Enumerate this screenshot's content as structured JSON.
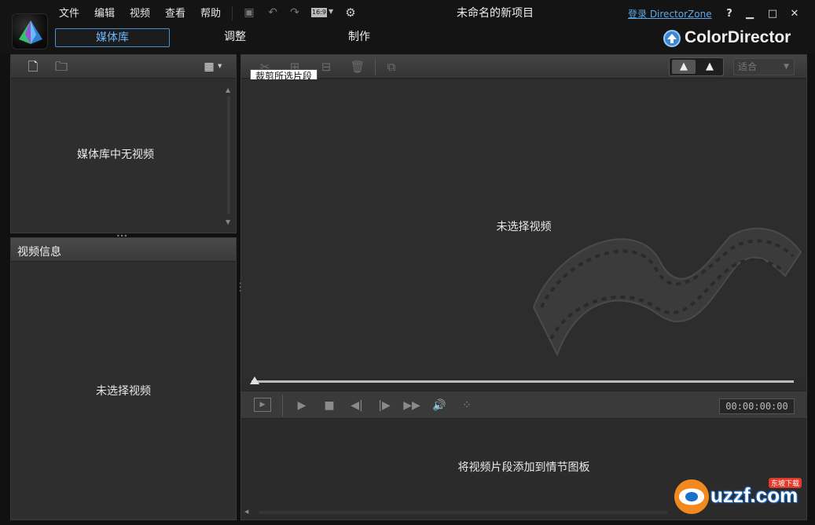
{
  "menu": [
    "文件",
    "编辑",
    "视频",
    "查看",
    "帮助"
  ],
  "window": {
    "title": "未命名的新项目",
    "login_link": "登录 DirectorZone",
    "help": "?",
    "minimize": "▁",
    "maximize": "□",
    "close": "✕",
    "aspect_ratio": "16:9"
  },
  "nav": {
    "tabs": [
      "媒体库",
      "调整",
      "制作"
    ],
    "active": "媒体库"
  },
  "brand": {
    "name": "ColorDirector",
    "badge_color": "#3c86d6"
  },
  "library": {
    "empty_text": "媒体库中无视频",
    "icons": [
      "import-media-icon",
      "import-folder-icon",
      "grid-view-icon"
    ]
  },
  "video_info": {
    "header": "视频信息",
    "empty_text": "未选择视频"
  },
  "preview": {
    "tooltip": "裁剪所选片段",
    "empty_text": "未选择视频",
    "fit_option": "适合",
    "timecode": "00:00:00:00"
  },
  "storyboard": {
    "hint": "将视频片段添加到情节图板"
  },
  "watermark": {
    "text": "uzzf.com",
    "badge": "东坡下载"
  },
  "colors": {
    "accent": "#4a8fd0",
    "link": "#5fa8e8",
    "panel_bg": "#2e2e2e",
    "app_bg": "#111111"
  }
}
